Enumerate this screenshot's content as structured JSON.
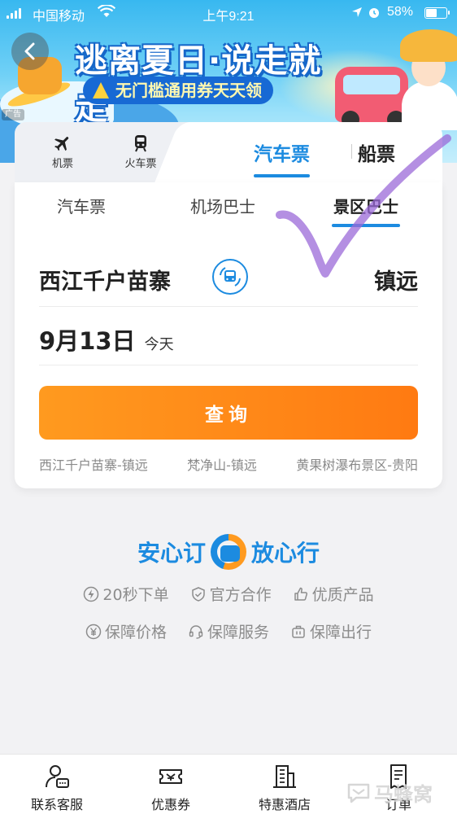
{
  "status_bar": {
    "carrier": "中国移动",
    "time": "上午9:21",
    "battery": "58%",
    "battery_level": 0.58
  },
  "banner": {
    "title": "逃离夏日·说走就走",
    "subtitle": "无门槛通用券天天领",
    "ad_tag": "广告"
  },
  "transport_tabs": {
    "flight": "机票",
    "train": "火车票",
    "bus": "汽车票",
    "ferry": "船票"
  },
  "sub_tabs": [
    "汽车票",
    "机场巴士",
    "景区巴士"
  ],
  "route": {
    "from": "西江千户苗寨",
    "to": "镇远"
  },
  "date": {
    "main": "9月13日",
    "label": "今天"
  },
  "query_button": "查询",
  "recent_routes": [
    "西江千户苗寨-镇远",
    "梵净山-镇远",
    "黄果树瀑布景区-贵阳"
  ],
  "promise": {
    "left": "安心订",
    "right": "放心行",
    "features_row1": [
      "20秒下单",
      "官方合作",
      "优质产品"
    ],
    "features_row2": [
      "保障价格",
      "保障服务",
      "保障出行"
    ]
  },
  "bottom_nav": [
    "联系客服",
    "优惠券",
    "特惠酒店",
    "订单"
  ],
  "watermark": "马蜂窝",
  "colors": {
    "accent_blue": "#1c8be0",
    "query_orange": "#ff8a17",
    "background": "#f2f2f4"
  }
}
